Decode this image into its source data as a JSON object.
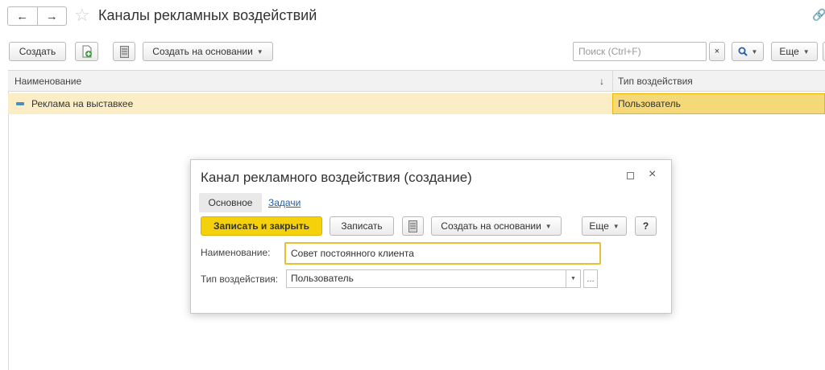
{
  "header": {
    "back_icon": "←",
    "forward_icon": "→",
    "title": "Каналы рекламных воздействий"
  },
  "toolbar": {
    "create_label": "Создать",
    "create_basis_label": "Создать на основании",
    "search_placeholder": "Поиск (Ctrl+F)",
    "search_clear": "×",
    "more_label": "Еще"
  },
  "list": {
    "columns": [
      "Наименование",
      "Тип воздействия"
    ],
    "sort_indicator": "↓",
    "rows": [
      {
        "name": "Реклама на выставкее",
        "type": "Пользователь"
      }
    ]
  },
  "dialog": {
    "title": "Канал рекламного воздействия (создание)",
    "tabs": [
      "Основное",
      "Задачи"
    ],
    "save_close_label": "Записать и закрыть",
    "save_label": "Записать",
    "create_basis_label": "Создать на основании",
    "more_label": "Еще",
    "help_label": "?",
    "name_label": "Наименование:",
    "name_value": "Совет постоянного клиента",
    "type_label": "Тип воздействия:",
    "type_value": "Пользователь",
    "type_select_label": "..."
  },
  "colors": {
    "accent_yellow": "#f5d10c",
    "selected_row": "#fbeec7",
    "link_blue": "#1f5ea8"
  }
}
